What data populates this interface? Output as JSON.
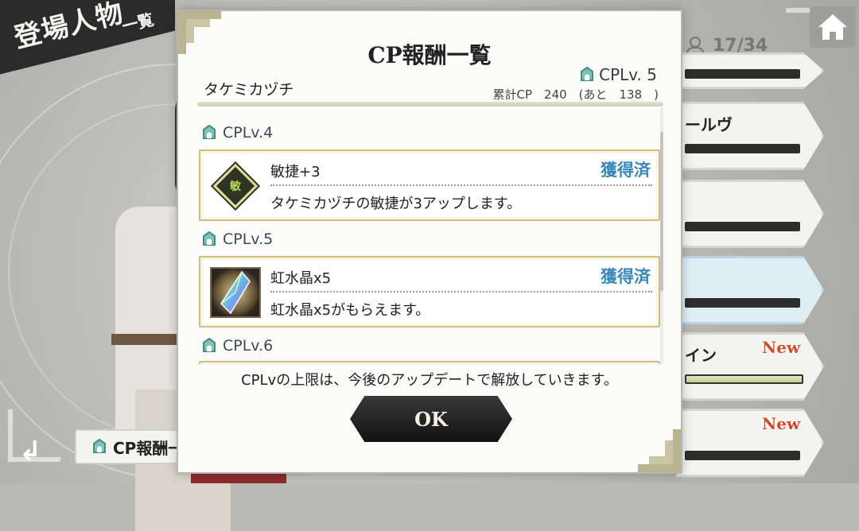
{
  "background": {
    "screen_title": "登場人物",
    "screen_subtitle": "一覧",
    "character_count": "17/34",
    "list_rows": [
      {
        "name": "",
        "new": ""
      },
      {
        "name": "ールヴ",
        "new": ""
      },
      {
        "name": "",
        "new": ""
      },
      {
        "name": "",
        "new": ""
      },
      {
        "name": "イン",
        "new": "New"
      },
      {
        "name": "",
        "new": "New"
      }
    ],
    "bottom_tab_label": "CP報酬一"
  },
  "modal": {
    "title": "CP報酬一覧",
    "character_name": "タケミカヅチ",
    "cp_level": "CPLv. 5",
    "cp_total": "累計CP　240　(あと　138　)",
    "levels": [
      {
        "label": "CPLv.4",
        "reward_name": "敏捷+3",
        "reward_desc": "タケミカヅチの敏捷が3アップします。",
        "status": "獲得済",
        "icon": "agility-stat-icon",
        "icon_text": "敏"
      },
      {
        "label": "CPLv.5",
        "reward_name": "虹水晶x5",
        "reward_desc": "虹水晶x5がもらえます。",
        "status": "獲得済",
        "icon": "rainbow-crystal-icon"
      },
      {
        "label": "CPLv.6"
      }
    ],
    "footer_note": "CPLvの上限は、今後のアップデートで解放していきます。",
    "ok_label": "OK"
  },
  "colors": {
    "accent_gold": "#cdbf86",
    "acquired_blue": "#3b88b6",
    "new_red": "#d24b2a",
    "dark_button": "#1a1a1a"
  }
}
